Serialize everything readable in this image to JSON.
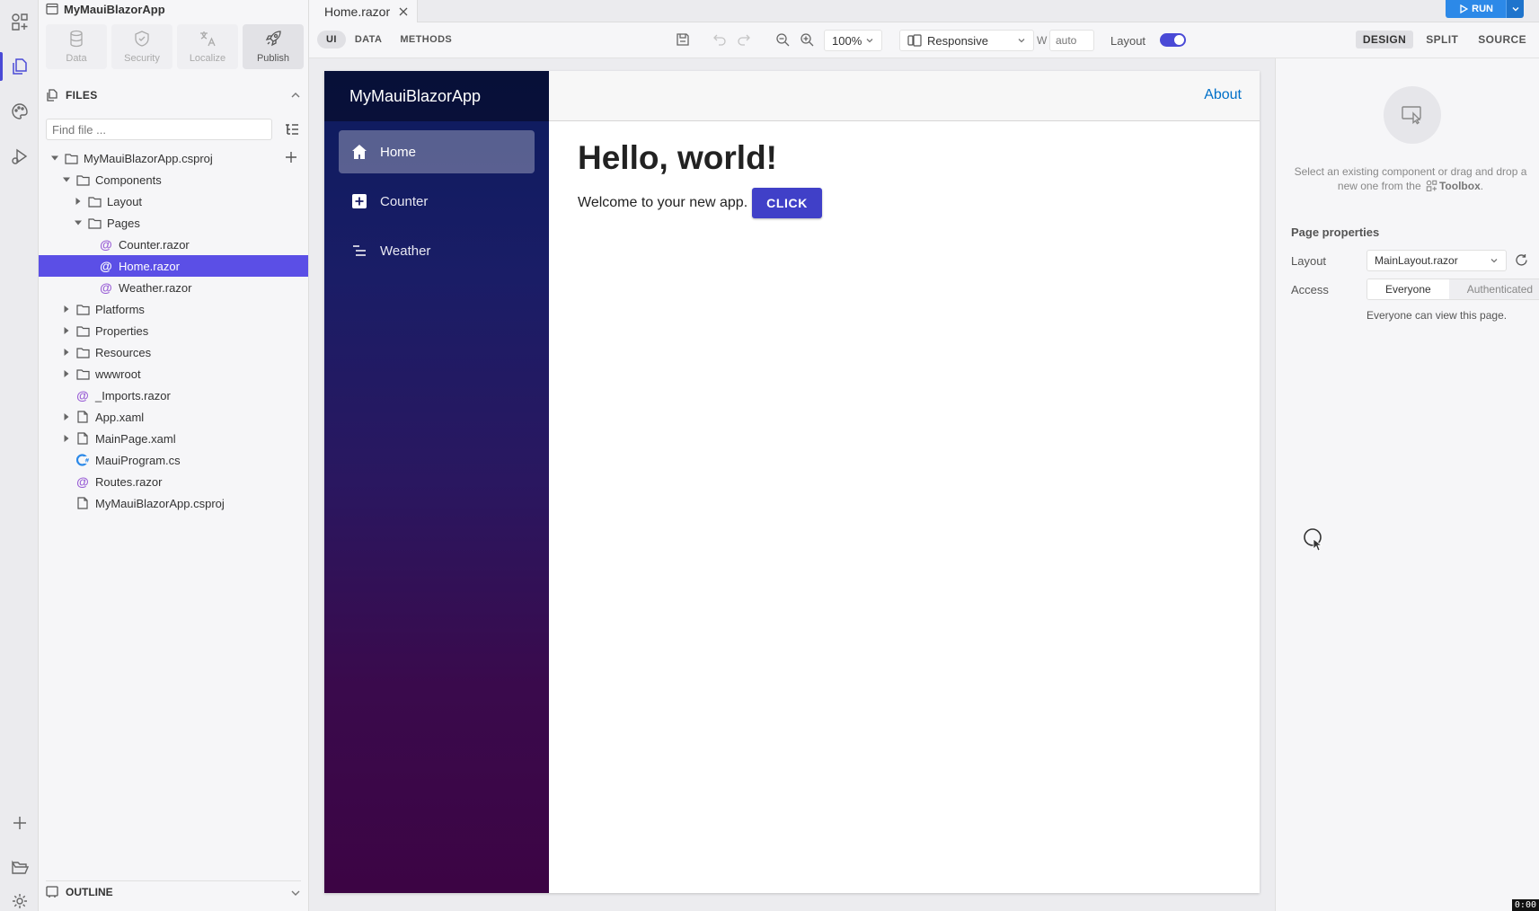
{
  "app": {
    "project_title": "MyMauiBlazorApp",
    "toolbar_buttons": [
      {
        "label": "Data",
        "icon": "database-icon"
      },
      {
        "label": "Security",
        "icon": "shield-icon"
      },
      {
        "label": "Localize",
        "icon": "translate-icon"
      },
      {
        "label": "Publish",
        "icon": "rocket-icon"
      }
    ]
  },
  "files": {
    "header": "FILES",
    "search_placeholder": "Find file ...",
    "tree": [
      {
        "label": "MyMauiBlazorApp.csproj",
        "type": "folder",
        "level": 0,
        "expanded": true
      },
      {
        "label": "Components",
        "type": "folder",
        "level": 1,
        "expanded": true
      },
      {
        "label": "Layout",
        "type": "folder",
        "level": 2,
        "expanded": false
      },
      {
        "label": "Pages",
        "type": "folder",
        "level": 2,
        "expanded": true
      },
      {
        "label": "Counter.razor",
        "type": "razor",
        "level": 3
      },
      {
        "label": "Home.razor",
        "type": "razor",
        "level": 3,
        "selected": true
      },
      {
        "label": "Weather.razor",
        "type": "razor",
        "level": 3
      },
      {
        "label": "Platforms",
        "type": "folder",
        "level": 1,
        "expanded": false
      },
      {
        "label": "Properties",
        "type": "folder",
        "level": 1,
        "expanded": false
      },
      {
        "label": "Resources",
        "type": "folder",
        "level": 1,
        "expanded": false
      },
      {
        "label": "wwwroot",
        "type": "folder",
        "level": 1,
        "expanded": false
      },
      {
        "label": "_Imports.razor",
        "type": "razor",
        "level": 1
      },
      {
        "label": "App.xaml",
        "type": "file",
        "level": 1,
        "expandable": true
      },
      {
        "label": "MainPage.xaml",
        "type": "file",
        "level": 1,
        "expandable": true
      },
      {
        "label": "MauiProgram.cs",
        "type": "csharp",
        "level": 1
      },
      {
        "label": "Routes.razor",
        "type": "razor",
        "level": 1
      },
      {
        "label": "MyMauiBlazorApp.csproj",
        "type": "file",
        "level": 1
      }
    ],
    "outline_header": "OUTLINE"
  },
  "editor": {
    "tab_label": "Home.razor",
    "run_label": "RUN",
    "modes": [
      "UI",
      "DATA",
      "METHODS"
    ],
    "zoom": "100%",
    "device": "Responsive",
    "width_label": "W",
    "width_value": "auto",
    "layout_label": "Layout",
    "view_modes": [
      "DESIGN",
      "SPLIT",
      "SOURCE"
    ]
  },
  "preview": {
    "brand": "MyMauiBlazorApp",
    "nav": [
      {
        "label": "Home",
        "icon": "home-icon",
        "active": true
      },
      {
        "label": "Counter",
        "icon": "plus-icon"
      },
      {
        "label": "Weather",
        "icon": "list-icon"
      }
    ],
    "about_link": "About",
    "heading": "Hello, world!",
    "welcome": "Welcome to your new app.",
    "button": "CLICK"
  },
  "properties": {
    "hint_pre": "Select an existing component or drag and drop a new one from the",
    "hint_toolbox": "Toolbox",
    "hint_post": ".",
    "section_title": "Page properties",
    "layout_label": "Layout",
    "layout_value": "MainLayout.razor",
    "access_label": "Access",
    "access_options": [
      "Everyone",
      "Authenticated"
    ],
    "access_hint": "Everyone can view this page."
  },
  "timer": "0:00"
}
